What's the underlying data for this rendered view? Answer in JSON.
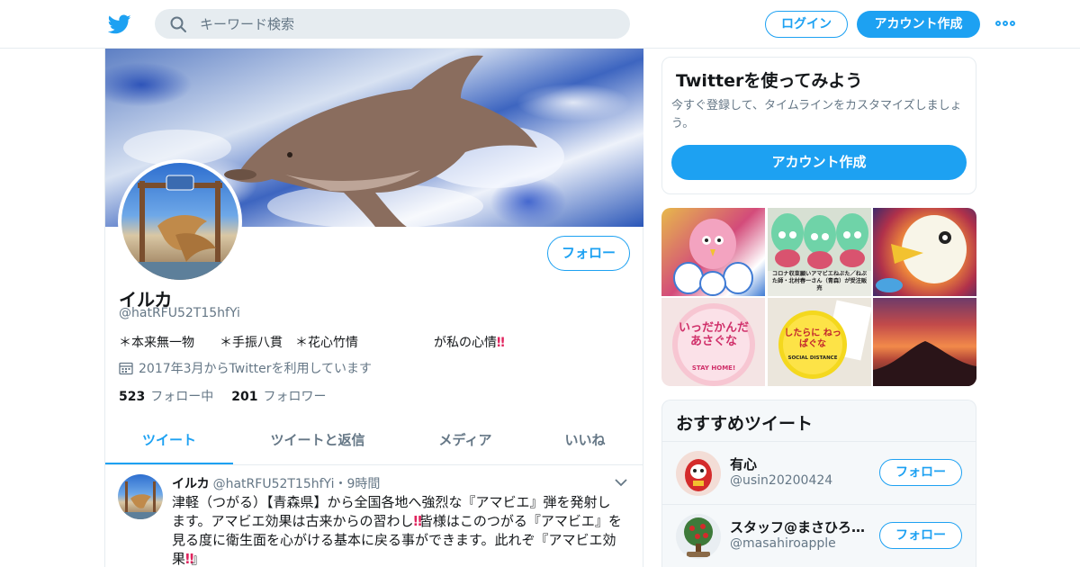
{
  "colors": {
    "accent": "#1da1f2",
    "border": "#e6ecf0",
    "muted": "#657786",
    "text": "#14171a",
    "emoji_red": "#e0245e"
  },
  "header": {
    "logo_icon": "twitter-bird-icon",
    "search_placeholder": "キーワード検索",
    "login_label": "ログイン",
    "signup_label": "アカウント作成",
    "more_icon": "more-dots-icon"
  },
  "profile": {
    "follow_label": "フォロー",
    "name": "イルカ",
    "handle": "@hatRFU52T15hfYi",
    "bio": "＊本来無一物　　＊手振八貫　＊花心竹情　　　　　　が私の心情",
    "bio_emoji": "‼",
    "joined": "2017年3月からTwitterを利用しています",
    "following_count": "523",
    "following_label": "フォロー中",
    "followers_count": "201",
    "followers_label": "フォロワー"
  },
  "tabs": [
    {
      "label": "ツイート",
      "active": true
    },
    {
      "label": "ツイートと返信",
      "active": false
    },
    {
      "label": "メディア",
      "active": false
    },
    {
      "label": "いいね",
      "active": false
    }
  ],
  "tweet": {
    "name": "イルカ",
    "handle": "@hatRFU52T15hfYi",
    "separator": "・",
    "time": "9時間",
    "text_1": "津軽（つがる）【青森県】から全国各地へ強烈な『アマビエ』弾を発射します。アマビエ効果は古来からの習わし",
    "text_2": "皆様はこのつがる『アマビエ』を見る度に衛生面を心がける基本に戻る事ができます。此れぞ『アマビエ効果",
    "text_3": "』",
    "emoji": "‼"
  },
  "signup_card": {
    "title": "Twitterを使ってみよう",
    "subtitle": "今すぐ登録して、タイムラインをカスタマイズしましょう。",
    "button_label": "アカウント作成"
  },
  "media": {
    "tile_2_caption": "コロナ収束願いアマビエねぶた／ねぶた師・北村春一さん（青森）が受注販売",
    "tile_4_text": "いっだかんだ あさぐな",
    "tile_4_sub": "STAY HOME!",
    "tile_5_text": "したらに ねっぱぐな",
    "tile_5_sub": "SOCIAL DISTANCE"
  },
  "recommended": {
    "title": "おすすめツイート",
    "follow_label": "フォロー",
    "users": [
      {
        "name": "有心",
        "handle": "@usin20200424"
      },
      {
        "name": "スタッフ@まさひろ…",
        "handle": "@masahiroapple"
      }
    ]
  }
}
